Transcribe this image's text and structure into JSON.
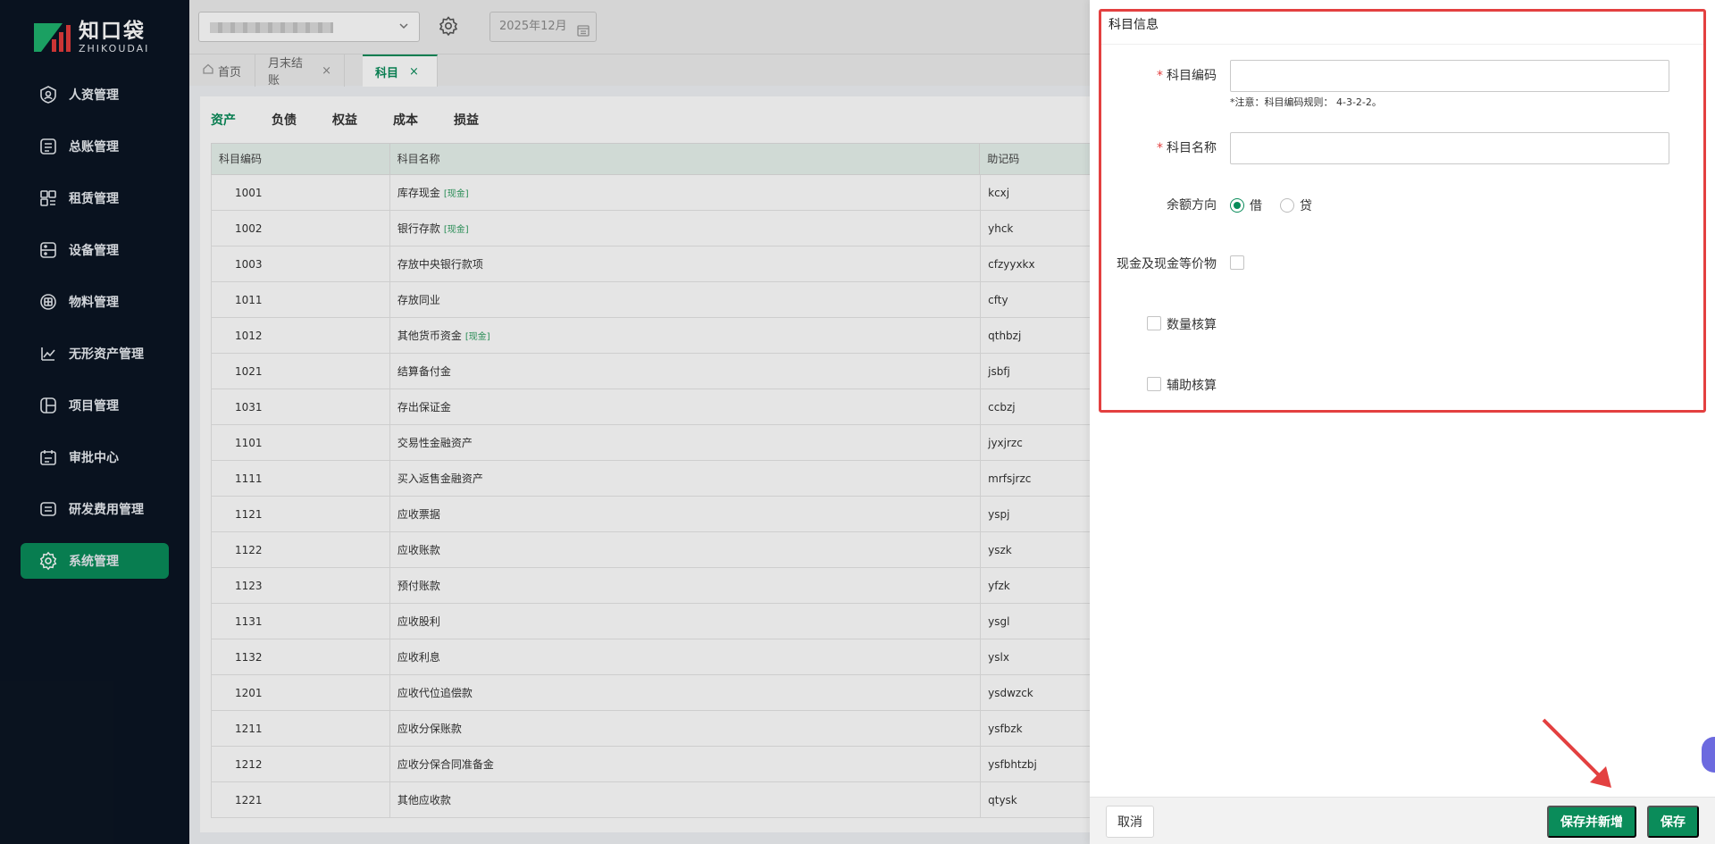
{
  "brand": {
    "name_cn": "知口袋",
    "name_en": "ZHIKOUDAI",
    "accent": "#0a8c5a"
  },
  "sidebar": {
    "items": [
      {
        "label": "人资管理",
        "icon": "person-badge-icon"
      },
      {
        "label": "总账管理",
        "icon": "ledger-icon"
      },
      {
        "label": "租赁管理",
        "icon": "lease-icon"
      },
      {
        "label": "设备管理",
        "icon": "device-icon"
      },
      {
        "label": "物料管理",
        "icon": "box-icon"
      },
      {
        "label": "无形资产管理",
        "icon": "intangible-chart-icon"
      },
      {
        "label": "项目管理",
        "icon": "project-icon"
      },
      {
        "label": "审批中心",
        "icon": "approval-icon"
      },
      {
        "label": "研发费用管理",
        "icon": "rd-cost-icon"
      },
      {
        "label": "系统管理",
        "icon": "gear-icon",
        "active": true
      }
    ]
  },
  "topbar": {
    "period": "2025年12月"
  },
  "tabs": [
    {
      "label": "首页"
    },
    {
      "label": "月末结账",
      "close": "×"
    },
    {
      "label": "科目",
      "close": "×",
      "active": true
    }
  ],
  "category_tabs": [
    "资产",
    "负债",
    "权益",
    "成本",
    "损益"
  ],
  "table": {
    "headers": [
      "科目编码",
      "科目名称",
      "助记码"
    ],
    "rows": [
      {
        "code": "1001",
        "name": "库存现金",
        "tag": "[现金]",
        "mnemonic": "kcxj"
      },
      {
        "code": "1002",
        "name": "银行存款",
        "tag": "[现金]",
        "mnemonic": "yhck"
      },
      {
        "code": "1003",
        "name": "存放中央银行款项",
        "tag": "",
        "mnemonic": "cfzyyxkx"
      },
      {
        "code": "1011",
        "name": "存放同业",
        "tag": "",
        "mnemonic": "cfty"
      },
      {
        "code": "1012",
        "name": "其他货币资金",
        "tag": "[现金]",
        "mnemonic": "qthbzj"
      },
      {
        "code": "1021",
        "name": "结算备付金",
        "tag": "",
        "mnemonic": "jsbfj"
      },
      {
        "code": "1031",
        "name": "存出保证金",
        "tag": "",
        "mnemonic": "ccbzj"
      },
      {
        "code": "1101",
        "name": "交易性金融资产",
        "tag": "",
        "mnemonic": "jyxjrzc"
      },
      {
        "code": "1111",
        "name": "买入返售金融资产",
        "tag": "",
        "mnemonic": "mrfsjrzc"
      },
      {
        "code": "1121",
        "name": "应收票据",
        "tag": "",
        "mnemonic": "yspj"
      },
      {
        "code": "1122",
        "name": "应收账款",
        "tag": "",
        "mnemonic": "yszk"
      },
      {
        "code": "1123",
        "name": "预付账款",
        "tag": "",
        "mnemonic": "yfzk"
      },
      {
        "code": "1131",
        "name": "应收股利",
        "tag": "",
        "mnemonic": "ysgl"
      },
      {
        "code": "1132",
        "name": "应收利息",
        "tag": "",
        "mnemonic": "yslx"
      },
      {
        "code": "1201",
        "name": "应收代位追偿款",
        "tag": "",
        "mnemonic": "ysdwzck"
      },
      {
        "code": "1211",
        "name": "应收分保账款",
        "tag": "",
        "mnemonic": "ysfbzk"
      },
      {
        "code": "1212",
        "name": "应收分保合同准备金",
        "tag": "",
        "mnemonic": "ysfbhtzbj"
      },
      {
        "code": "1221",
        "name": "其他应收款",
        "tag": "",
        "mnemonic": "qtysk"
      }
    ]
  },
  "drawer": {
    "title": "科目信息",
    "required_mark": "*",
    "fields": {
      "code_label": "科目编码",
      "code_value": "",
      "code_hint": "*注意：科目编码规则： 4-3-2-2。",
      "name_label": "科目名称",
      "name_value": "",
      "direction_label": "余额方向",
      "direction_options": [
        "借",
        "贷"
      ],
      "direction_selected": "借",
      "cash_equiv_label": "现金及现金等价物",
      "quantity_label": "数量核算",
      "auxiliary_label": "辅助核算"
    },
    "footer": {
      "cancel": "取消",
      "save_and_new": "保存并新增",
      "save": "保存"
    }
  }
}
